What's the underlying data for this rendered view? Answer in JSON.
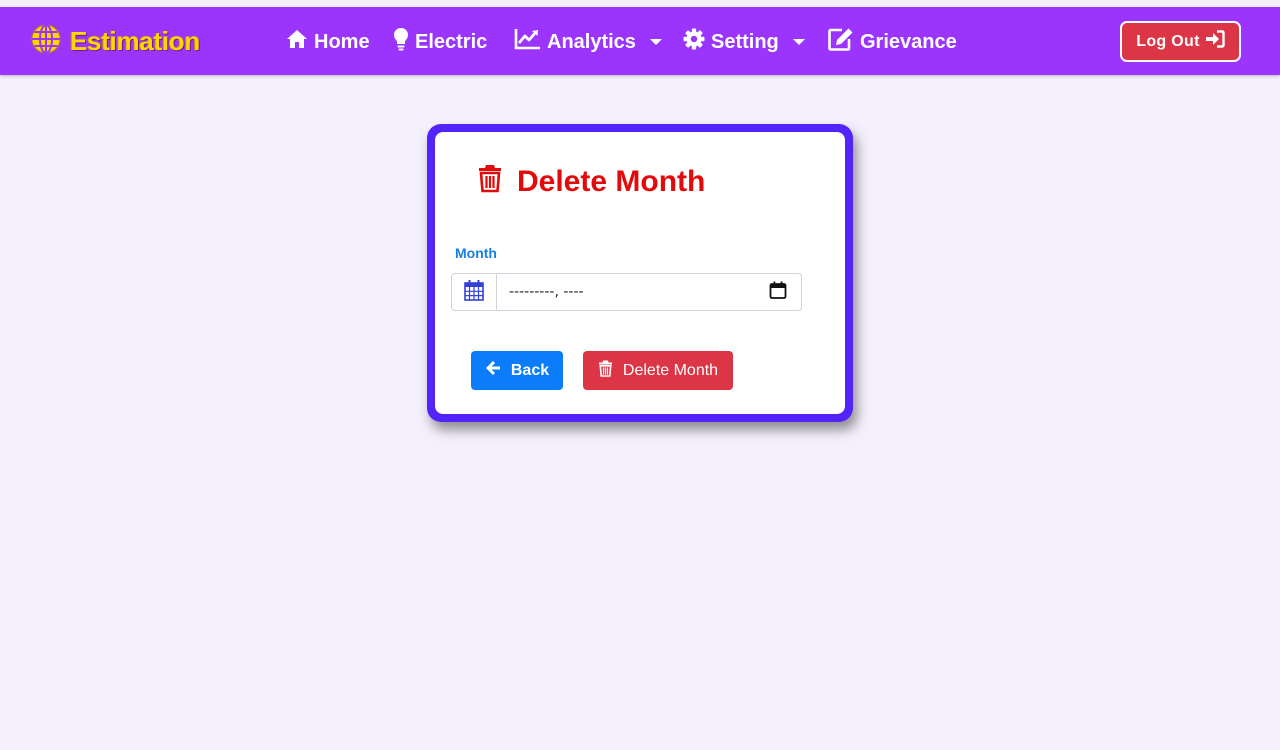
{
  "nav": {
    "brand": "Estimation",
    "items": [
      {
        "label": "Home",
        "icon": "home-icon"
      },
      {
        "label": "Electric",
        "icon": "lightbulb-icon"
      },
      {
        "label": "Analytics",
        "icon": "chart-line-icon",
        "dropdown": true
      },
      {
        "label": "Setting",
        "icon": "gear-icon",
        "dropdown": true
      },
      {
        "label": "Grievance",
        "icon": "edit-icon"
      }
    ],
    "logout_label": "Log Out"
  },
  "form": {
    "title": "Delete Month",
    "month_label": "Month",
    "month_value": "---------, ----",
    "back_label": "Back",
    "delete_label": "Delete Month"
  },
  "colors": {
    "navbar": "#9b35fd",
    "brand": "#ffd400",
    "card_border": "#5224fa",
    "title": "#e20a0a",
    "back_button": "#0b7dfa",
    "danger": "#dc3545",
    "page_background": "#f5f0fd"
  }
}
